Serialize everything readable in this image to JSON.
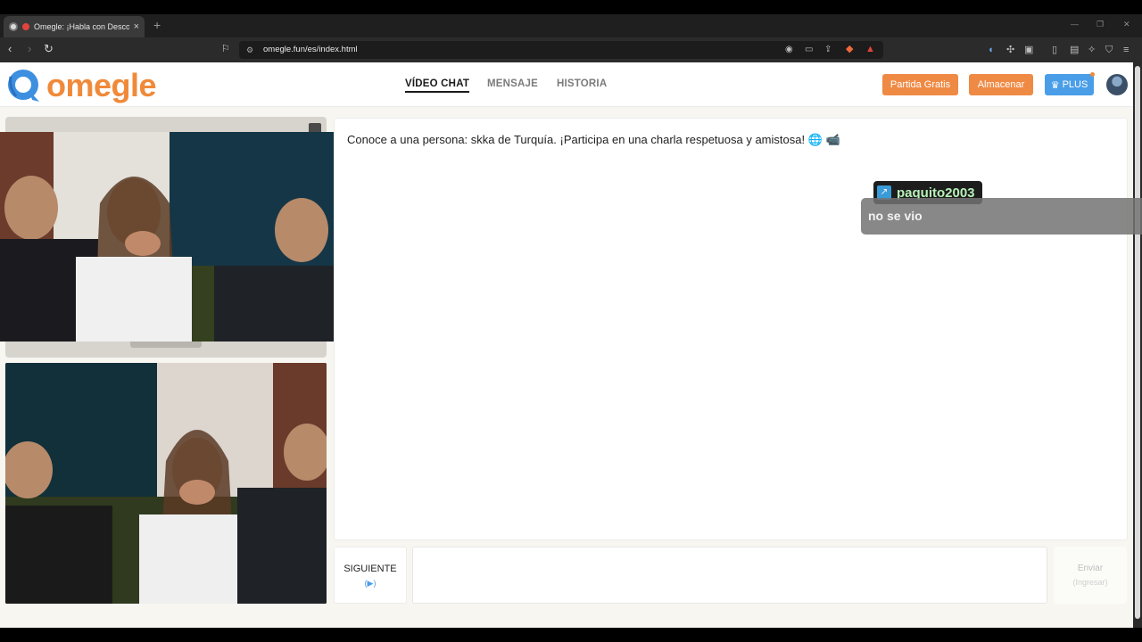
{
  "browser": {
    "tab_title": "Omegle: ¡Habla con Descono",
    "tab_close": "×",
    "new_tab": "+",
    "url": "omegle.fun/es/index.html",
    "window_controls": [
      "—",
      "❐",
      "✕"
    ]
  },
  "site": {
    "logo_text": "omegle",
    "nav": [
      {
        "label": "VÍDEO CHAT",
        "active": true
      },
      {
        "label": "MENSAJE",
        "active": false
      },
      {
        "label": "HISTORIA",
        "active": false
      }
    ],
    "buttons": {
      "free_game": "Partida Gratis",
      "store": "Almacenar",
      "plus": "PLUS"
    },
    "colors": {
      "accent_orange": "#ef8a45",
      "accent_blue": "#4a9ee8",
      "background": "#f7f6f1"
    }
  },
  "chat": {
    "intro": "Conoce a una persona: skka de Turquía. ¡Participa en una charla respetuosa y amistosa! 🌐 📹",
    "next_label": "SIGUIENTE",
    "next_hint": "(▶)",
    "send_label": "Enviar",
    "send_hint": "(Ingresar)",
    "message_value": ""
  },
  "overlay": {
    "username": "paquito2003",
    "message": "no se vio"
  }
}
